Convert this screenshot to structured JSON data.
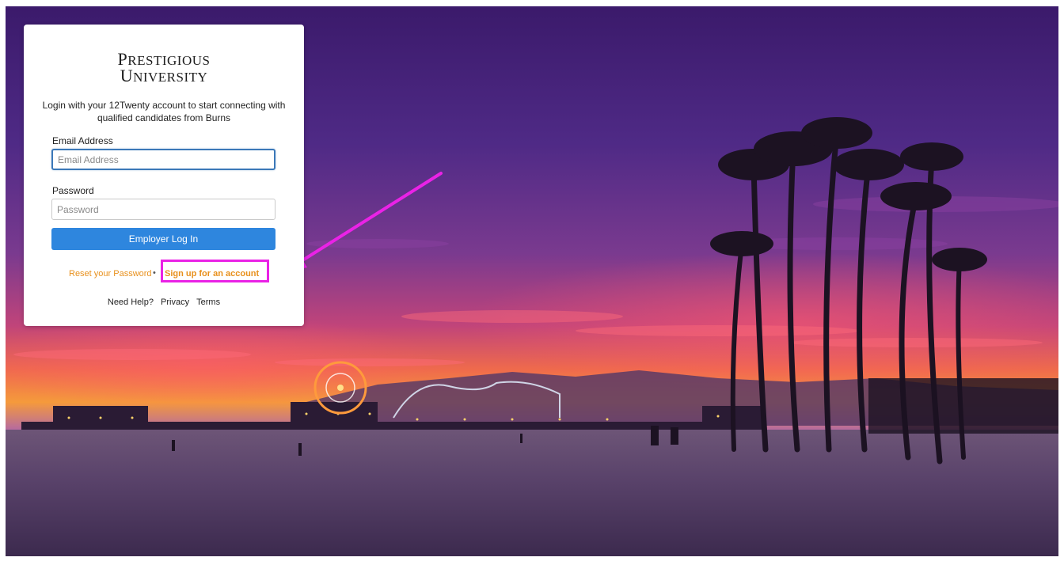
{
  "login": {
    "logo_line1_cap": "P",
    "logo_line1_rest": "RESTIGIOUS",
    "logo_line2_cap": "U",
    "logo_line2_rest": "NIVERSITY",
    "intro_text": "Login with your 12Twenty account to start connecting with qualified candidates from Burns",
    "email_label": "Email Address",
    "email_placeholder": "Email Address",
    "email_value": "",
    "password_label": "Password",
    "password_placeholder": "Password",
    "password_value": "",
    "login_button_label": "Employer Log In",
    "reset_password_label": "Reset your Password",
    "separator": "•",
    "signup_label": "Sign up for an account",
    "footer": {
      "help_label": "Need Help?",
      "privacy_label": "Privacy",
      "terms_label": "Terms"
    }
  },
  "colors": {
    "accent_blue": "#2e86de",
    "link_orange": "#e8901c",
    "annotation_magenta": "#ea22e6"
  },
  "icons": {
    "annotation": "arrow-icon"
  }
}
